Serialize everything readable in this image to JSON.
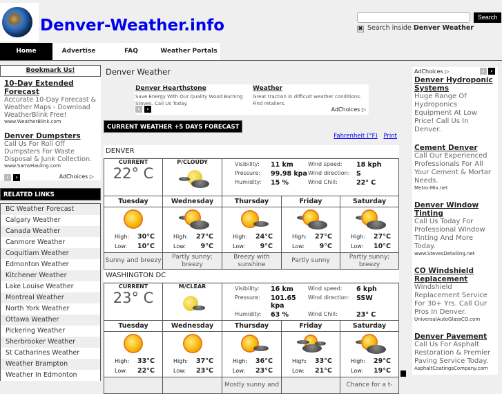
{
  "header": {
    "site_title": "Denver-Weather.info",
    "search": {
      "placeholder": "",
      "value": "",
      "button": "Search",
      "checkbox_checked": true,
      "label_prefix": "Search inside ",
      "label_bold": "Denver Weather"
    }
  },
  "nav": {
    "items": [
      {
        "label": "Home",
        "active": true
      },
      {
        "label": "Advertise"
      },
      {
        "label": "FAQ"
      },
      {
        "label": "Weather Portals"
      }
    ]
  },
  "left": {
    "bookmark": "Bookmark Us!",
    "ads": [
      {
        "title": "10-Day Extended Forecast",
        "desc": "Accurate 10-Day Forecast & Weather Maps - Download WeatherBlink Free!",
        "url": "www.WeatherBlink.com"
      },
      {
        "title": "Denver Dumpsters",
        "desc": "Call Us For Roll Off Dumpsters For Waste Disposal & Junk Collection.",
        "url": "www.SamsHauling.com"
      }
    ],
    "adchoices": "AdChoices ▷",
    "related_heading": "RELATED LINKS",
    "related": [
      "BC Weather Forecast",
      "Calgary Weather",
      "Canada Weather",
      "Canmore Weather",
      "Coquitlam Weather",
      "Edmonton Weather",
      "Kitchener Weather",
      "Lake Louise Weather",
      "Montreal Weather",
      "North York Weather",
      "Ottawa Weather",
      "Pickering Weather",
      "Sherbrooker Weather",
      "St Catharines Weather",
      "Weather Brampton",
      "Weather In Edmonton"
    ]
  },
  "main": {
    "title": "Denver Weather",
    "top_ads": [
      {
        "title": "Denver Hearthstone",
        "desc": "Save Energy With Our Quality Wood Burning Stoves. Call Us Today."
      },
      {
        "title": "Weather",
        "desc": "Great traction in difficult weather conditions. Find retailers."
      }
    ],
    "adchoices": "AdChoices ▷",
    "forecast_heading": "CURRENT WEATHER +5 DAYS FORECAST",
    "links": {
      "unit": "Fahrenheit (°F)",
      "print": "Print"
    },
    "labels": {
      "current": "CURRENT",
      "visibility": "Visibility:",
      "pressure": "Pressure:",
      "humidity": "Humidity:",
      "wind_speed": "Wind speed:",
      "wind_direction": "Wind direction:",
      "wind_chill": "Wind Chill:",
      "high": "High:",
      "low": "Low:"
    },
    "cities": [
      {
        "name": "DENVER",
        "current_temp": "22° C",
        "condition": "P/CLOUDY",
        "visibility": "11 km",
        "pressure": "99.98 kpa",
        "humidity": "15 %",
        "wind_speed": "18 kph",
        "wind_direction": "S",
        "wind_chill": "22° C",
        "days": [
          {
            "day": "Tuesday",
            "icon": "sunny",
            "high": "30°C",
            "low": "10°C",
            "desc": "Sunny and breezy"
          },
          {
            "day": "Wednesday",
            "icon": "partly-cloudy",
            "high": "27°C",
            "low": "9°C",
            "desc": "Partly sunny; breezy"
          },
          {
            "day": "Thursday",
            "icon": "mostly-sunny",
            "high": "24°C",
            "low": "9°C",
            "desc": "Breezy with sunshine"
          },
          {
            "day": "Friday",
            "icon": "partly-cloudy",
            "high": "27°C",
            "low": "9°C",
            "desc": "Partly sunny"
          },
          {
            "day": "Saturday",
            "icon": "partly-cloudy",
            "high": "27°C",
            "low": "10°C",
            "desc": "Partly sunny; breezy"
          }
        ]
      },
      {
        "name": "WASHINGTON DC",
        "current_temp": "23° C",
        "condition": "M/CLEAR",
        "visibility": "16 km",
        "pressure": "101.65 kpa",
        "humidity": "63 %",
        "wind_speed": "6 kph",
        "wind_direction": "SSW",
        "wind_chill": "23° C",
        "days": [
          {
            "day": "Tuesday",
            "icon": "sunny",
            "high": "33°C",
            "low": "22°C",
            "desc": ""
          },
          {
            "day": "Wednesday",
            "icon": "sunny",
            "high": "37°C",
            "low": "23°C",
            "desc": ""
          },
          {
            "day": "Thursday",
            "icon": "mostly-sunny",
            "high": "36°C",
            "low": "23°C",
            "desc": "Mostly sunny and"
          },
          {
            "day": "Friday",
            "icon": "cloudy",
            "high": "33°C",
            "low": "21°C",
            "desc": ""
          },
          {
            "day": "Saturday",
            "icon": "partly-cloudy",
            "high": "29°C",
            "low": "19°C",
            "desc": "Chance for a t-"
          }
        ]
      }
    ]
  },
  "right": {
    "adchoices": "AdChoices ▷",
    "ads": [
      {
        "title": "Denver Hydroponic Systems",
        "desc": "Huge Range Of Hydroponics Equipment At Low Price! Call Us In Denver.",
        "url": ""
      },
      {
        "title": "Cement Denver",
        "desc": "Call Our Experienced Professionals For All Your Cement & Mortar Needs.",
        "url": "Metro-Mix.net"
      },
      {
        "title": "Denver Window Tinting",
        "desc": "Call Us Today For Professional Window Tinting And More Today.",
        "url": "www.StevesDetailing.net"
      },
      {
        "title": "CO Windshield Replacement",
        "desc": "Windshield Replacement Service For 30+ Yrs. Call Our Pros In Denver.",
        "url": "UniversalAutoGlassCO.com"
      },
      {
        "title": "Denver Pavement",
        "desc": "Call Us For Asphalt Restoration & Premier Paving Service Today.",
        "url": "AsphaltCoatingsCompany.com"
      }
    ]
  }
}
